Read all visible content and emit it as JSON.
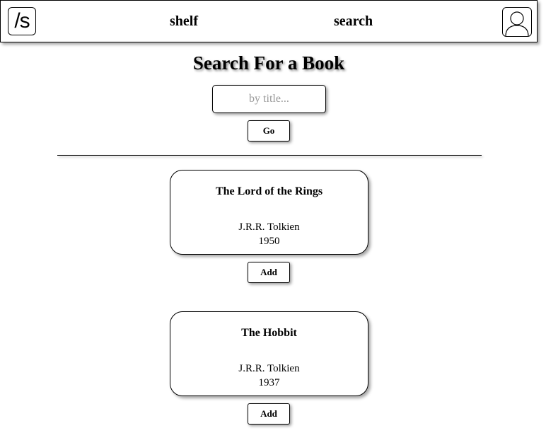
{
  "nav": {
    "logo_text": "/s",
    "shelf_label": "shelf",
    "search_label": "search",
    "avatar_icon": "user-icon"
  },
  "search": {
    "heading": "Search For a Book",
    "placeholder": "by title...",
    "value": "",
    "go_label": "Go"
  },
  "results": [
    {
      "title": "The Lord of the Rings",
      "author": "J.R.R. Tolkien",
      "year": "1950",
      "add_label": "Add"
    },
    {
      "title": "The Hobbit",
      "author": "J.R.R. Tolkien",
      "year": "1937",
      "add_label": "Add"
    }
  ]
}
